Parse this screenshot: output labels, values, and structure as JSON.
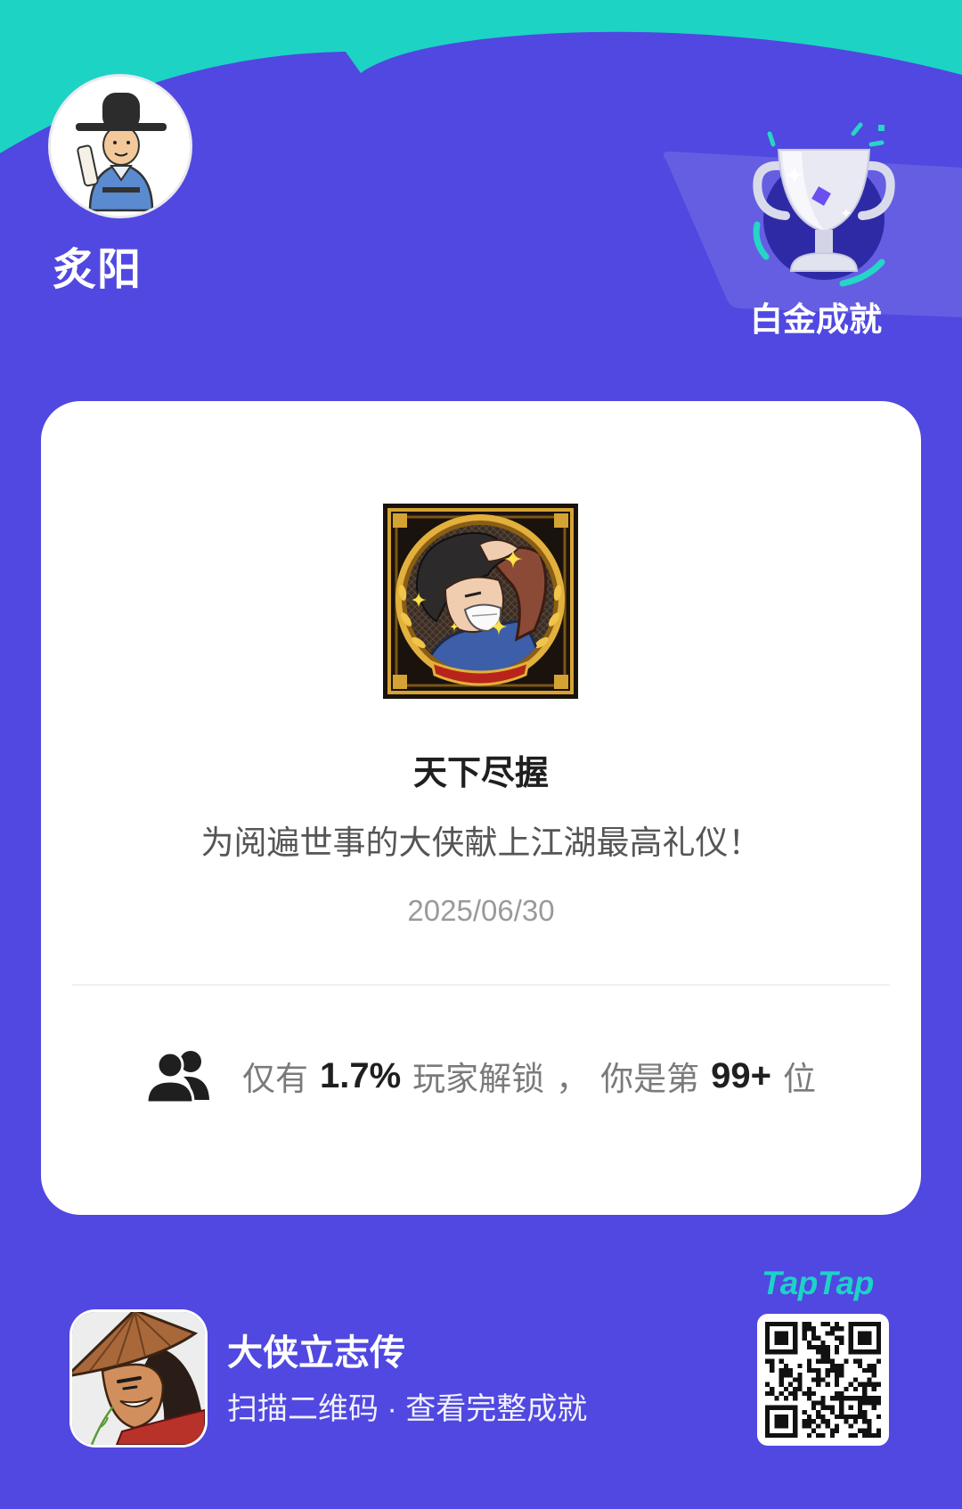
{
  "user": {
    "name": "炙阳"
  },
  "badge": {
    "label": "白金成就"
  },
  "achievement": {
    "title": "天下尽握",
    "description": "为阅遍世事的大侠献上江湖最高礼仪！",
    "date": "2025/06/30"
  },
  "stats": {
    "prefix": "仅有",
    "percent": "1.7%",
    "middle": "玩家解锁",
    "comma": "，",
    "rank_prefix": "你是第",
    "rank": "99+",
    "suffix": "位"
  },
  "game": {
    "name": "大侠立志传",
    "hint": "扫描二维码 · 查看完整成就"
  },
  "brand": {
    "logo": "TapTap"
  },
  "icons": {
    "avatar": "user-avatar",
    "badge": "trophy-icon",
    "achievement": "achievement-badge-icon",
    "players": "players-icon",
    "game": "game-icon",
    "qr": "qr-code"
  },
  "colors": {
    "background": "#5048E0",
    "accent": "#1DD3C4",
    "card": "#FFFFFF",
    "trophy_circle": "#2E2AA6"
  }
}
